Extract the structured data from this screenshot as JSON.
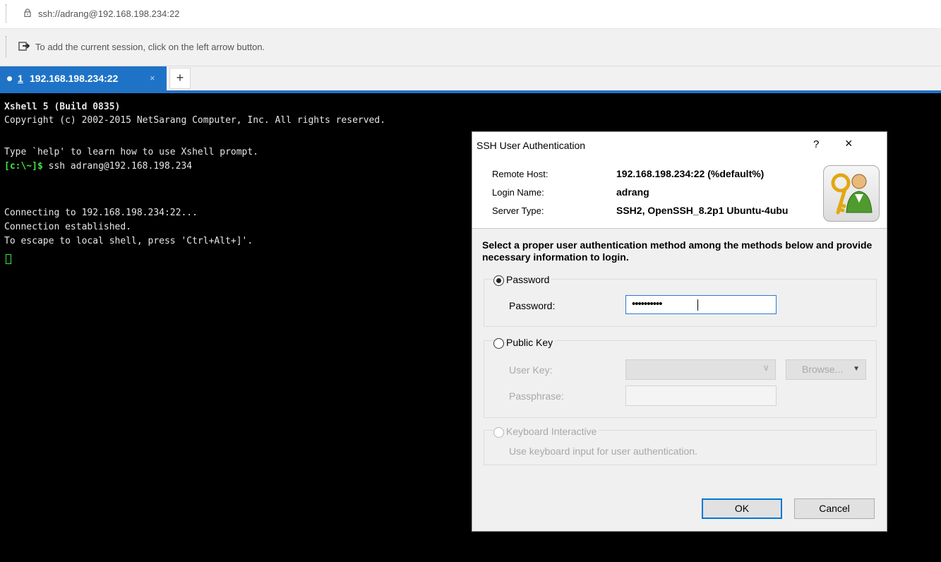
{
  "address_bar": {
    "url": "ssh://adrang@192.168.198.234:22",
    "lock_icon": "lock-icon"
  },
  "info_bar": {
    "text": "To add the current session, click on the left arrow button.",
    "icon": "session-arrow-icon"
  },
  "tabs": [
    {
      "number": "1",
      "label": "192.168.198.234:22",
      "close": "×"
    }
  ],
  "add_tab_label": "+",
  "colors": {
    "accent": "#1f73c7",
    "prompt_green": "#43e243",
    "terminal_bg": "#000000"
  },
  "terminal": {
    "lines": {
      "l1": "Xshell 5 (Build 0835)",
      "l2": "Copyright (c) 2002-2015 NetSarang Computer, Inc. All rights reserved.",
      "l3": "Type `help' to learn how to use Xshell prompt.",
      "prompt": "[c:\\~]$",
      "command": " ssh adrang@192.168.198.234",
      "l5": "Connecting to 192.168.198.234:22...",
      "l6": "Connection established.",
      "l7": "To escape to local shell, press 'Ctrl+Alt+]'."
    }
  },
  "dialog": {
    "title": "SSH User Authentication",
    "help": "?",
    "close": "×",
    "remote_host_label": "Remote Host:",
    "remote_host_value": "192.168.198.234:22 (%default%)",
    "login_name_label": "Login Name:",
    "login_name_value": "adrang",
    "server_type_label": "Server Type:",
    "server_type_value": "SSH2, OpenSSH_8.2p1 Ubuntu-4ubu",
    "instructions": "Select a proper user authentication method among the methods below and provide necessary information to login.",
    "password_method": {
      "label": "Password",
      "field_label": "Password:",
      "value_masked": "••••••••••",
      "selected": true
    },
    "public_key_method": {
      "label": "Public Key",
      "user_key_label": "User Key:",
      "user_key_value": "",
      "browse_label": "Browse...",
      "passphrase_label": "Passphrase:",
      "selected": false
    },
    "keyboard_method": {
      "label": "Keyboard Interactive",
      "description": "Use keyboard input for user authentication.",
      "selected": false
    },
    "ok_label": "OK",
    "cancel_label": "Cancel"
  }
}
